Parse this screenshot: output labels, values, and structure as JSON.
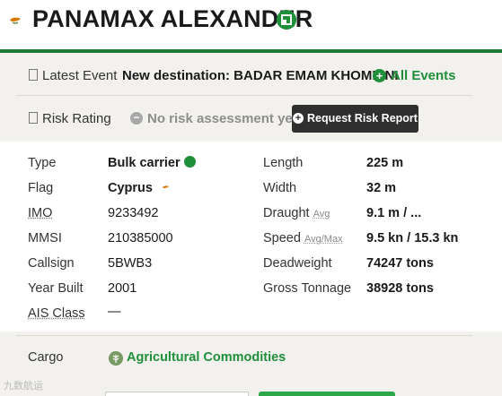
{
  "vessel": {
    "name": "PANAMAX ALEXANDER",
    "flag_country": "Cyprus"
  },
  "latest_event": {
    "label": "Latest Event",
    "text": "New destination: BADAR EMAM KHOMIENI",
    "link_label": "All Events"
  },
  "risk": {
    "label": "Risk Rating",
    "status": "No risk assessment yet",
    "button_label": "Request Risk Report"
  },
  "details_left": [
    {
      "label": "Type",
      "value": "Bulk carrier"
    },
    {
      "label": "Flag",
      "value": "Cyprus"
    },
    {
      "label": "IMO",
      "value": "9233492"
    },
    {
      "label": "MMSI",
      "value": "210385000"
    },
    {
      "label": "Callsign",
      "value": "5BWB3"
    },
    {
      "label": "Year Built",
      "value": "2001"
    },
    {
      "label": "AIS Class",
      "value": "—"
    }
  ],
  "details_right": [
    {
      "label": "Length",
      "sublabel": "",
      "value": "225 m"
    },
    {
      "label": "Width",
      "sublabel": "",
      "value": "32 m"
    },
    {
      "label": "Draught",
      "sublabel": "Avg",
      "value": "9.1 m / ..."
    },
    {
      "label": "Speed",
      "sublabel": "Avg/Max",
      "value": "9.5 kn / 15.3 kn"
    },
    {
      "label": "Deadweight",
      "sublabel": "",
      "value": "74247 tons"
    },
    {
      "label": "Gross Tonnage",
      "sublabel": "",
      "value": "38928 tons"
    }
  ],
  "cargo": {
    "label": "Cargo",
    "value": "Agricultural Commodities"
  },
  "watermark": "九数航运",
  "colors": {
    "accent_green": "#1f8f3a",
    "rule_green": "#1f7a34",
    "button_dark": "#2f2f2f",
    "panel_bg": "#f3f1ee"
  },
  "icons": [
    "cyprus-flag-icon",
    "bulk-carrier-badge-icon",
    "plus-circle-icon",
    "minus-circle-icon",
    "cargo-leaf-icon"
  ]
}
